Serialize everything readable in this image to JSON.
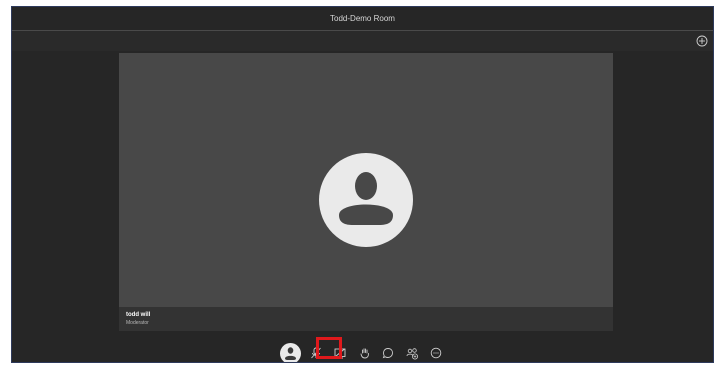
{
  "window": {
    "title": "Todd-Demo Room"
  },
  "tabbar": {
    "add_icon": "plus-circle-icon"
  },
  "stage": {
    "participant": {
      "name": "todd will",
      "role": "Moderator",
      "avatar_icon": "user-silhouette-icon"
    }
  },
  "controls": [
    {
      "name": "self-avatar",
      "icon": "user-avatar-icon"
    },
    {
      "name": "microphone-muted",
      "icon": "mic-off-icon"
    },
    {
      "name": "screen-share",
      "icon": "screen-share-off-icon",
      "highlighted": true
    },
    {
      "name": "raise-hand",
      "icon": "hand-icon"
    },
    {
      "name": "chat",
      "icon": "chat-bubble-icon"
    },
    {
      "name": "participants",
      "icon": "people-icon"
    },
    {
      "name": "more-options",
      "icon": "ellipsis-circle-icon"
    }
  ],
  "colors": {
    "background": "#262626",
    "stage": "#484848",
    "highlight": "#e0191c"
  }
}
